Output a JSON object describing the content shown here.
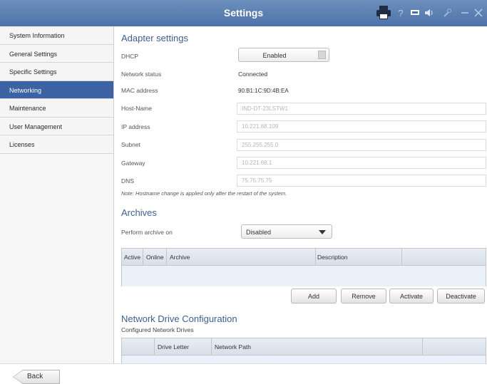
{
  "window": {
    "title": "Settings",
    "toolbar_icons": [
      "printer-icon",
      "help-icon",
      "display-icon",
      "speaker-icon",
      "wrench-icon",
      "minimize-icon",
      "close-icon"
    ]
  },
  "sidebar": {
    "items": [
      {
        "label": "System Information",
        "active": false
      },
      {
        "label": "General Settings",
        "active": false
      },
      {
        "label": "Specific Settings",
        "active": false
      },
      {
        "label": "Networking",
        "active": true
      },
      {
        "label": "Maintenance",
        "active": false
      },
      {
        "label": "User Management",
        "active": false
      },
      {
        "label": "Licenses",
        "active": false
      }
    ]
  },
  "adapter": {
    "heading": "Adapter settings",
    "dhcp_label": "DHCP",
    "dhcp_value": "Enabled",
    "status_label": "Network status",
    "status_value": "Connected",
    "mac_label": "MAC address",
    "mac_value": "90:B1:1C:9D:4B:EA",
    "host_label": "Host-Name",
    "host_value": "IND-DT-23LSTW1",
    "ip_label": "IP address",
    "ip_value": "10.221.68.109",
    "subnet_label": "Subnet",
    "subnet_value": "255.255.255.0",
    "gateway_label": "Gateway",
    "gateway_value": "10.221.68.1",
    "dns_label": "DNS",
    "dns_value": "75.75.75.75",
    "note": "Note: Hostname change is applied only after the restart of the system."
  },
  "archives": {
    "heading": "Archives",
    "perform_label": "Perform archive on",
    "perform_value": "Disabled",
    "columns": [
      "Active",
      "Online",
      "Archive",
      "Description"
    ],
    "buttons": {
      "add": "Add",
      "remove": "Remove",
      "activate": "Activate",
      "deactivate": "Deactivate"
    }
  },
  "network_drive": {
    "heading": "Network Drive Configuration",
    "subheading": "Configured Network Drives",
    "columns": [
      "Drive Letter",
      "Network Path"
    ]
  },
  "footer": {
    "back_label": "Back"
  },
  "colors": {
    "titlebar": "#5a7db2",
    "active_nav": "#3b63a3",
    "section_heading": "#3a5f98"
  }
}
